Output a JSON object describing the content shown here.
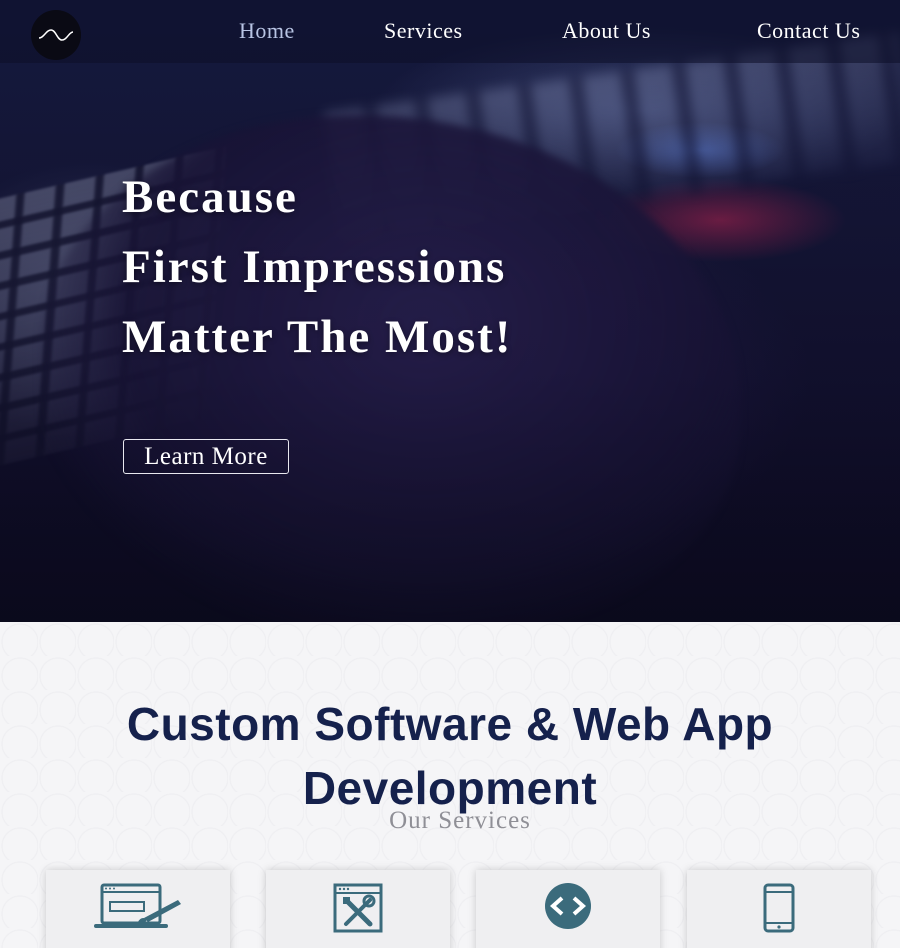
{
  "nav": {
    "links": [
      {
        "label": "Home"
      },
      {
        "label": "Services"
      },
      {
        "label": "About Us"
      },
      {
        "label": "Contact Us"
      }
    ]
  },
  "hero": {
    "title_lines": [
      "Because",
      "First Impressions",
      "Matter The Most!"
    ],
    "cta_label": "Learn More"
  },
  "services": {
    "heading_lines": [
      "Custom Software & Web App",
      "Development"
    ],
    "subheading": "Our Services",
    "cards": [
      {
        "icon": "web-design-icon"
      },
      {
        "icon": "tools-icon"
      },
      {
        "icon": "code-icon"
      },
      {
        "icon": "mobile-icon"
      }
    ]
  },
  "colors": {
    "heading": "#15214c",
    "icon": "#3b6b7c",
    "subheading": "#8f8f96"
  }
}
